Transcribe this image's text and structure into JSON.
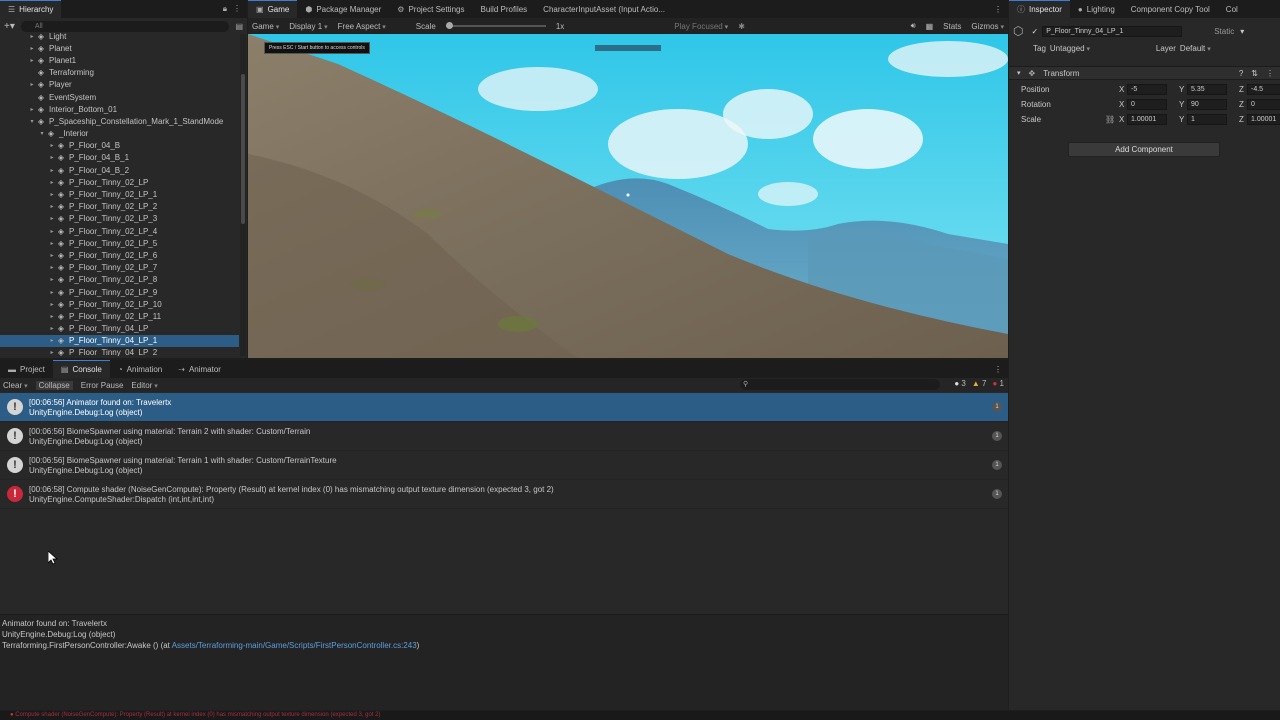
{
  "hierarchy": {
    "tab_label": "Hierarchy",
    "search_placeholder": "All",
    "items": [
      {
        "label": "Light",
        "depth": 0,
        "arrow": "▸"
      },
      {
        "label": "Planet",
        "depth": 0,
        "arrow": "▸"
      },
      {
        "label": "Planet1",
        "depth": 0,
        "arrow": "▸"
      },
      {
        "label": "Terraforming",
        "depth": 0,
        "arrow": ""
      },
      {
        "label": "Player",
        "depth": 0,
        "arrow": "▸"
      },
      {
        "label": "EventSystem",
        "depth": 0,
        "arrow": ""
      },
      {
        "label": "Interior_Bottom_01",
        "depth": 0,
        "arrow": "▸"
      },
      {
        "label": "P_Spaceship_Constellation_Mark_1_StandMode",
        "depth": 0,
        "arrow": "▾"
      },
      {
        "label": "_Interior",
        "depth": 1,
        "arrow": "▾"
      },
      {
        "label": "P_Floor_04_B",
        "depth": 2,
        "arrow": "▸"
      },
      {
        "label": "P_Floor_04_B_1",
        "depth": 2,
        "arrow": "▸"
      },
      {
        "label": "P_Floor_04_B_2",
        "depth": 2,
        "arrow": "▸"
      },
      {
        "label": "P_Floor_Tinny_02_LP",
        "depth": 2,
        "arrow": "▸"
      },
      {
        "label": "P_Floor_Tinny_02_LP_1",
        "depth": 2,
        "arrow": "▸"
      },
      {
        "label": "P_Floor_Tinny_02_LP_2",
        "depth": 2,
        "arrow": "▸"
      },
      {
        "label": "P_Floor_Tinny_02_LP_3",
        "depth": 2,
        "arrow": "▸"
      },
      {
        "label": "P_Floor_Tinny_02_LP_4",
        "depth": 2,
        "arrow": "▸"
      },
      {
        "label": "P_Floor_Tinny_02_LP_5",
        "depth": 2,
        "arrow": "▸"
      },
      {
        "label": "P_Floor_Tinny_02_LP_6",
        "depth": 2,
        "arrow": "▸"
      },
      {
        "label": "P_Floor_Tinny_02_LP_7",
        "depth": 2,
        "arrow": "▸"
      },
      {
        "label": "P_Floor_Tinny_02_LP_8",
        "depth": 2,
        "arrow": "▸"
      },
      {
        "label": "P_Floor_Tinny_02_LP_9",
        "depth": 2,
        "arrow": "▸"
      },
      {
        "label": "P_Floor_Tinny_02_LP_10",
        "depth": 2,
        "arrow": "▸"
      },
      {
        "label": "P_Floor_Tinny_02_LP_11",
        "depth": 2,
        "arrow": "▸"
      },
      {
        "label": "P_Floor_Tinny_04_LP",
        "depth": 2,
        "arrow": "▸"
      },
      {
        "label": "P_Floor_Tinny_04_LP_1",
        "depth": 2,
        "arrow": "▸",
        "selected": true
      },
      {
        "label": "P_Floor_Tinny_04_LP_2",
        "depth": 2,
        "arrow": "▸"
      }
    ]
  },
  "game": {
    "tabs": [
      "Game",
      "Package Manager",
      "Project Settings",
      "Build Profiles",
      "CharacterInputAsset (Input Actio..."
    ],
    "toolbar": {
      "mode": "Game",
      "display": "Display 1",
      "aspect": "Free Aspect",
      "scale_label": "Scale",
      "scale_value": "1x",
      "play_focused": "Play Focused",
      "stats": "Stats",
      "gizmos": "Gizmos"
    },
    "hint": "Press ESC / Start button to access controls"
  },
  "inspector": {
    "tabs": [
      "Inspector",
      "Lighting",
      "Component Copy Tool",
      "Col"
    ],
    "object_name": "P_Floor_Tinny_04_LP_1",
    "static_label": "Static",
    "tag_label": "Tag",
    "tag_value": "Untagged",
    "layer_label": "Layer",
    "layer_value": "Default",
    "transform_label": "Transform",
    "position_label": "Position",
    "rotation_label": "Rotation",
    "scale_label": "Scale",
    "position": {
      "x": "-5",
      "y": "5.35",
      "z": "-4.5"
    },
    "rotation": {
      "x": "0",
      "y": "90",
      "z": "0"
    },
    "scale": {
      "x": "1.00001",
      "y": "1",
      "z": "1.00001"
    },
    "add_component": "Add Component"
  },
  "console": {
    "tabs": [
      "Project",
      "Console",
      "Animation",
      "Animator"
    ],
    "toolbar": {
      "clear": "Clear",
      "collapse": "Collapse",
      "error_pause": "Error Pause",
      "editor": "Editor"
    },
    "counts": {
      "info": "3",
      "warn": "7",
      "error": "1"
    },
    "logs": [
      {
        "line1": "[00:06:56] Animator found on: Travelertx",
        "line2": "UnityEngine.Debug:Log (object)",
        "type": "info",
        "count": "1",
        "selected": true
      },
      {
        "line1": "[00:06:56] BiomeSpawner using material: Terrain 2 with shader: Custom/Terrain",
        "line2": "UnityEngine.Debug:Log (object)",
        "type": "info",
        "count": "1"
      },
      {
        "line1": "[00:06:56] BiomeSpawner using material: Terrain 1 with shader: Custom/TerrainTexture",
        "line2": "UnityEngine.Debug:Log (object)",
        "type": "info",
        "count": "1"
      },
      {
        "line1": "[00:06:58] Compute shader (NoiseGenCompute): Property (Result) at kernel index (0) has mismatching output texture dimension (expected 3, got 2)",
        "line2": "UnityEngine.ComputeShader:Dispatch (int,int,int,int)",
        "type": "error",
        "count": "1"
      }
    ],
    "details": {
      "line1": "Animator found on: Travelertx",
      "line2": "UnityEngine.Debug:Log (object)",
      "line3_prefix": "Terraforming.FirstPersonController:Awake () (at ",
      "line3_link": "Assets/Terraforming-main/Game/Scripts/FirstPersonController.cs:243",
      "line3_suffix": ")"
    }
  },
  "statusbar": {
    "message": "Compute shader (NoiseGenCompute): Property (Result) at kernel index (0) has mismatching output texture dimension (expected 3, got 2)"
  }
}
